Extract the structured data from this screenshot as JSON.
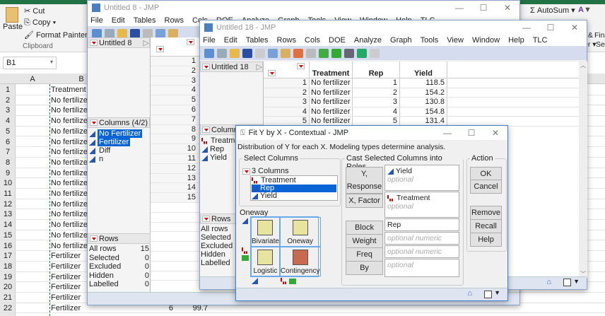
{
  "excel": {
    "clipboard": {
      "paste": "Paste",
      "cut": "Cut",
      "copy": "Copy",
      "format_painter": "Format Painter",
      "group": "Clipboard"
    },
    "editing": {
      "autosum": "AutoSum",
      "sort_filter": "t & Fi",
      "find": "Fin",
      "filter2": "er",
      "select": "Sel"
    },
    "name_box": "B1",
    "columns": [
      "A",
      "B"
    ],
    "rows": [
      {
        "n": "1",
        "b": "Treatment"
      },
      {
        "n": "2",
        "b": "No fertilize"
      },
      {
        "n": "3",
        "b": "No fertilize"
      },
      {
        "n": "4",
        "b": "No fertilize"
      },
      {
        "n": "5",
        "b": "No fertilize"
      },
      {
        "n": "6",
        "b": "No fertilize"
      },
      {
        "n": "7",
        "b": "No fertilize"
      },
      {
        "n": "8",
        "b": "No fertilize"
      },
      {
        "n": "9",
        "b": "No fertilize"
      },
      {
        "n": "10",
        "b": "No fertilize"
      },
      {
        "n": "11",
        "b": "No fertilize"
      },
      {
        "n": "12",
        "b": "No fertilize"
      },
      {
        "n": "13",
        "b": "No fertilize"
      },
      {
        "n": "14",
        "b": "No fertilize"
      },
      {
        "n": "15",
        "b": "No fertilize"
      },
      {
        "n": "16",
        "b": "No fertilize"
      },
      {
        "n": "17",
        "b": "Fertilizer"
      },
      {
        "n": "18",
        "b": "Fertilizer"
      },
      {
        "n": "19",
        "b": "Fertilizer"
      },
      {
        "n": "20",
        "b": "Fertilizer"
      },
      {
        "n": "21",
        "b": "Fertilizer"
      },
      {
        "n": "22",
        "b": "Fertilizer"
      }
    ],
    "partial_row": {
      "c": "6",
      "d": "99.7"
    }
  },
  "jmp8": {
    "title": "Untitled 8 - JMP",
    "menu": [
      "File",
      "Edit",
      "Tables",
      "Rows",
      "Cols",
      "DOE",
      "Analyze",
      "Graph",
      "Tools",
      "View",
      "Window",
      "Help",
      "TLC"
    ],
    "table_name": "Untitled 8",
    "columns_header": "Columns (4/2)",
    "columns": [
      {
        "name": "No Fertilizer",
        "selected": true
      },
      {
        "name": "Fertilizer",
        "selected": true
      },
      {
        "name": "Diff",
        "selected": false
      },
      {
        "name": "n",
        "selected": false
      }
    ],
    "row_numbers": [
      "1",
      "2",
      "3",
      "4",
      "5",
      "6",
      "7",
      "8",
      "9",
      "10",
      "11",
      "12",
      "13",
      "14",
      "15"
    ],
    "rows_header": "Rows",
    "rows_stats": [
      {
        "label": "All rows",
        "value": "15"
      },
      {
        "label": "Selected",
        "value": "0"
      },
      {
        "label": "Excluded",
        "value": "0"
      },
      {
        "label": "Hidden",
        "value": "0"
      },
      {
        "label": "Labelled",
        "value": "0"
      }
    ]
  },
  "jmp18": {
    "title": "Untitled 18 - JMP",
    "menu": [
      "File",
      "Edit",
      "Tables",
      "Rows",
      "Cols",
      "DOE",
      "Analyze",
      "Graph",
      "Tools",
      "View",
      "Window",
      "Help",
      "TLC"
    ],
    "table_name": "Untitled 18",
    "headers": [
      "Treatment",
      "Rep",
      "Yield"
    ],
    "rows": [
      {
        "n": "1",
        "t": "No fertilizer",
        "r": "1",
        "y": "118.5"
      },
      {
        "n": "2",
        "t": "No fertilizer",
        "r": "2",
        "y": "154.2"
      },
      {
        "n": "3",
        "t": "No fertilizer",
        "r": "3",
        "y": "130.8"
      },
      {
        "n": "4",
        "t": "No fertilizer",
        "r": "4",
        "y": "154.8"
      },
      {
        "n": "5",
        "t": "No fertilizer",
        "r": "5",
        "y": "131.4"
      }
    ],
    "columns_header": "Columns",
    "columns": [
      {
        "name": "Treatmen",
        "type": "nominal"
      },
      {
        "name": "Rep",
        "type": "continuous"
      },
      {
        "name": "Yield",
        "type": "continuous"
      }
    ],
    "rows_header": "Rows",
    "rows_labels": [
      "All rows",
      "Selected",
      "Excluded",
      "Hidden",
      "Labelled"
    ]
  },
  "dialog": {
    "title": "Fit Y by X - Contextual - JMP",
    "description": "Distribution of Y for each X. Modeling types determine analysis.",
    "select_columns": {
      "label": "Select Columns",
      "count": "3 Columns",
      "items": [
        {
          "name": "Treatment",
          "type": "nominal",
          "selected": false
        },
        {
          "name": "Rep",
          "type": "continuous",
          "selected": true
        },
        {
          "name": "Yield",
          "type": "continuous",
          "selected": false
        }
      ]
    },
    "analysis_label": "Oneway",
    "analyses": [
      "Bivariate",
      "Oneway",
      "Logistic",
      "Contingency"
    ],
    "cast": {
      "label": "Cast Selected Columns into Roles",
      "roles": [
        {
          "button": "Y, Response",
          "value": "Yield",
          "value_type": "continuous",
          "hint": "optional"
        },
        {
          "button": "X, Factor",
          "value": "Treatment",
          "value_type": "nominal",
          "hint": "optional"
        },
        {
          "button": "Block",
          "value": "Rep",
          "hint": ""
        },
        {
          "button": "Weight",
          "value": "",
          "hint": "optional numeric"
        },
        {
          "button": "Freq",
          "value": "",
          "hint": "optional numeric"
        },
        {
          "button": "By",
          "value": "",
          "hint": "optional"
        }
      ]
    },
    "action": {
      "label": "Action",
      "ok": "OK",
      "cancel": "Cancel",
      "remove": "Remove",
      "recall": "Recall",
      "help": "Help"
    }
  },
  "colors": {
    "excel_green": "#217346",
    "jmp_toolbar": "#d4dcee",
    "selection": "#0a64d6",
    "nominal_red": "#cc0000",
    "continuous_blue": "#2457b5"
  }
}
